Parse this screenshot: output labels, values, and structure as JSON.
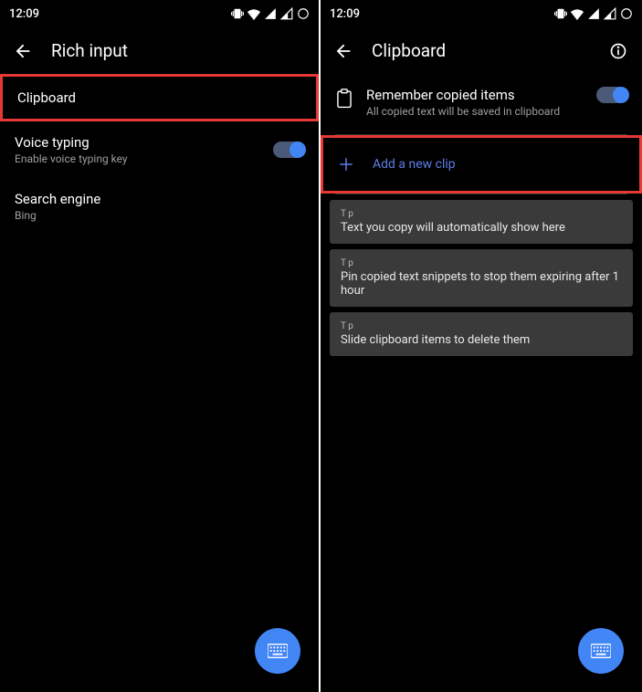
{
  "status": {
    "time": "12:09"
  },
  "left": {
    "title": "Rich input",
    "clipboard": "Clipboard",
    "voice_title": "Voice typing",
    "voice_sub": "Enable voice typing key",
    "search_title": "Search engine",
    "search_sub": "Bing"
  },
  "right": {
    "title": "Clipboard",
    "remember_title": "Remember copied items",
    "remember_sub": "All copied text will be saved in clipboard",
    "add_clip": "Add a new clip",
    "tips": [
      {
        "label": "T p",
        "text": "Text you copy will automatically show here"
      },
      {
        "label": "T p",
        "text": "Pin copied text snippets to stop them expiring after 1 hour"
      },
      {
        "label": "T p",
        "text": "Slide clipboard items to delete them"
      }
    ]
  }
}
